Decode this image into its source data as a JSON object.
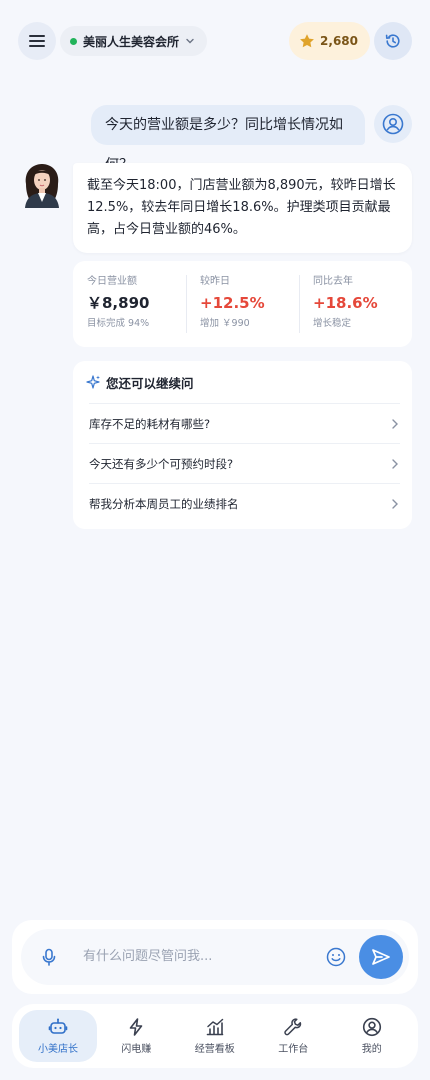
{
  "header": {
    "store_name": "美丽人生美容会所",
    "points": "2,680"
  },
  "chat": {
    "user_question": "今天的营业额是多少？同比增长情况如何？",
    "bot_answer": "截至今天18:00，门店营业额为8,890元，较昨日增长12.5%，较去年同日增长18.6%。护理类项目贡献最高，占今日营业额的46%。"
  },
  "stats": [
    {
      "label": "今日营业额",
      "value": "￥8,890",
      "sub": "目标完成 94%"
    },
    {
      "label": "较昨日",
      "value": "+12.5%",
      "sub": "增加 ￥990"
    },
    {
      "label": "同比去年",
      "value": "+18.6%",
      "sub": "增长稳定"
    }
  ],
  "followup": {
    "title": "您还可以继续问",
    "items": [
      "库存不足的耗材有哪些?",
      "今天还有多少个可预约时段?",
      "帮我分析本周员工的业绩排名"
    ]
  },
  "input": {
    "placeholder": "有什么问题尽管问我..."
  },
  "tabs": [
    {
      "label": "小美店长",
      "icon": "robot-icon",
      "active": true
    },
    {
      "label": "闪电赚",
      "icon": "lightning-icon",
      "active": false
    },
    {
      "label": "经营看板",
      "icon": "chart-icon",
      "active": false
    },
    {
      "label": "工作台",
      "icon": "wrench-icon",
      "active": false
    },
    {
      "label": "我的",
      "icon": "user-icon",
      "active": false
    }
  ],
  "colors": {
    "accent": "#4a8ee4",
    "positive": "#e5483a",
    "status_online": "#21b35a",
    "background": "#f5f7fc"
  }
}
